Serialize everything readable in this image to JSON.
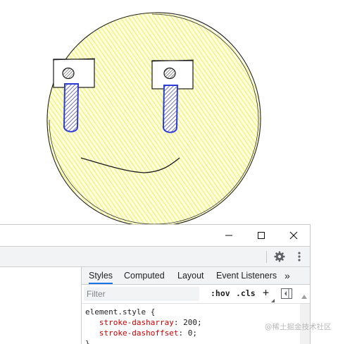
{
  "devtools": {
    "window_controls": [
      "minimize-icon",
      "maximize-icon",
      "close-icon"
    ],
    "toolbar_icons": [
      "gear-icon",
      "kebab-menu-icon"
    ],
    "tabs": [
      {
        "label": "Styles",
        "active": true
      },
      {
        "label": "Computed",
        "active": false
      },
      {
        "label": "Layout",
        "active": false
      },
      {
        "label": "Event Listeners",
        "active": false
      },
      {
        "label": "»",
        "active": false
      }
    ],
    "filter": {
      "placeholder": "Filter",
      "value": ""
    },
    "filter_buttons": {
      "hov": ":hov",
      "cls": ".cls",
      "add": "+"
    },
    "styles": {
      "selector": "element.style {",
      "rules": [
        {
          "property": "stroke-dasharray",
          "value": "200"
        },
        {
          "property": "stroke-dashoffset",
          "value": "0"
        }
      ],
      "closing": "}"
    }
  },
  "watermark": "@稀土掘金技术社区",
  "colors": {
    "face_fill": "#fdfbb0",
    "tear_fill": "#3b46d6",
    "accent": "#1a73e8",
    "property_name": "#c80000"
  }
}
